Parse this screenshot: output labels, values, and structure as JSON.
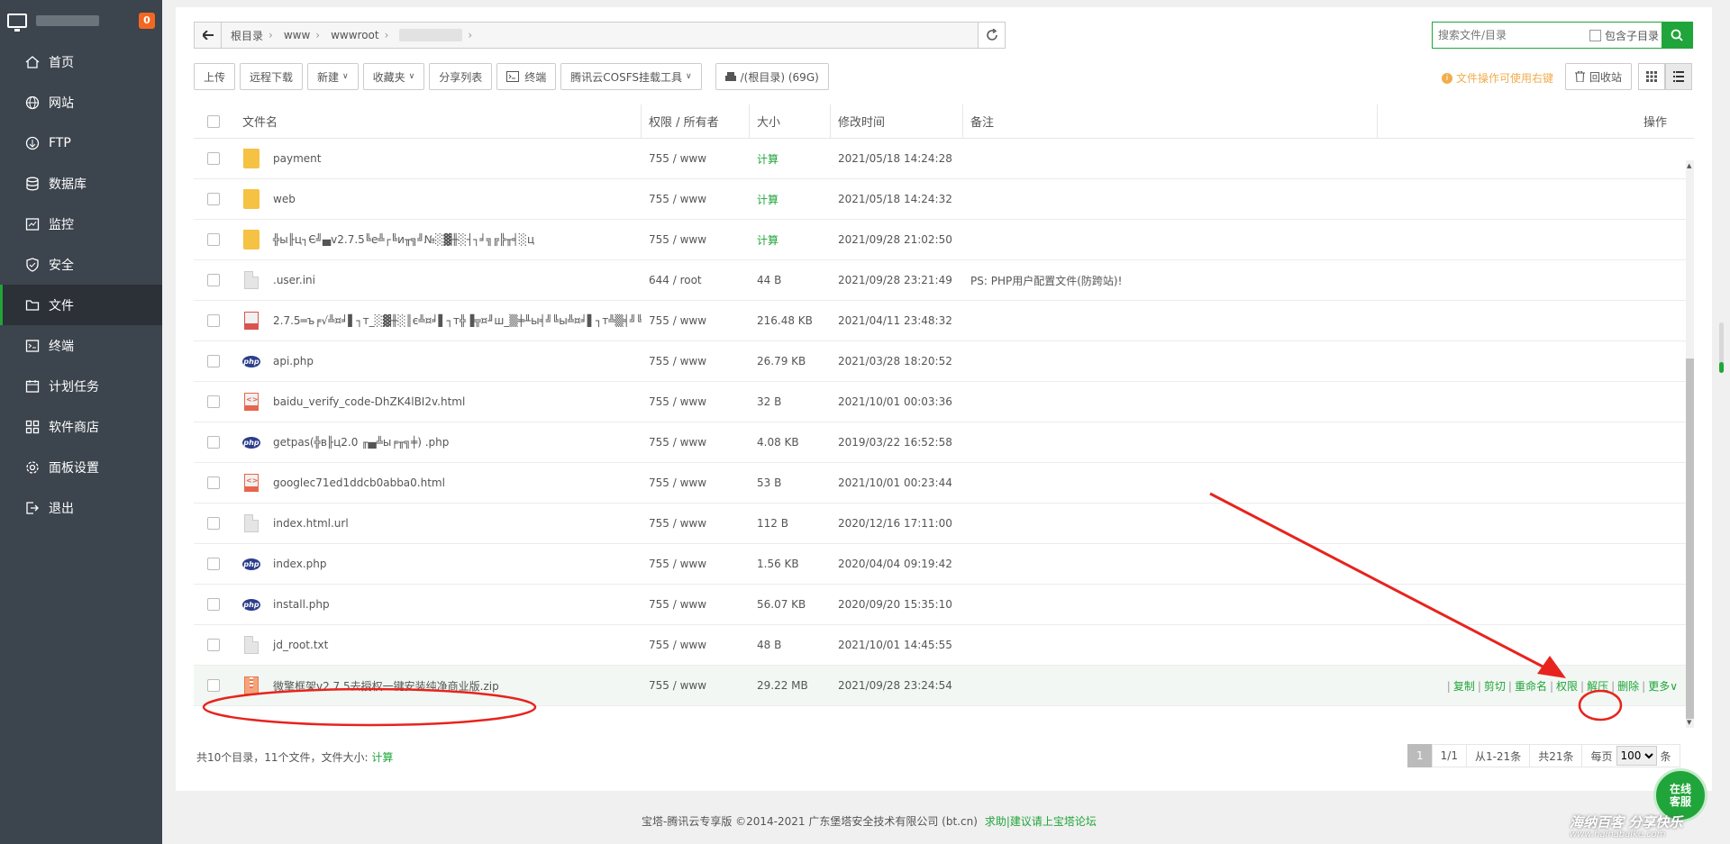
{
  "sidebar": {
    "badge": "0",
    "items": [
      {
        "label": "首页",
        "icon": "home-icon"
      },
      {
        "label": "网站",
        "icon": "globe-icon"
      },
      {
        "label": "FTP",
        "icon": "ftp-icon"
      },
      {
        "label": "数据库",
        "icon": "database-icon"
      },
      {
        "label": "监控",
        "icon": "monitor-icon"
      },
      {
        "label": "安全",
        "icon": "shield-icon"
      },
      {
        "label": "文件",
        "icon": "folder-icon"
      },
      {
        "label": "终端",
        "icon": "terminal-icon"
      },
      {
        "label": "计划任务",
        "icon": "schedule-icon"
      },
      {
        "label": "软件商店",
        "icon": "apps-icon"
      },
      {
        "label": "面板设置",
        "icon": "gear-icon"
      },
      {
        "label": "退出",
        "icon": "logout-icon"
      }
    ]
  },
  "path": {
    "crumbs": [
      "根目录",
      "www",
      "wwwroot"
    ]
  },
  "search": {
    "placeholder": "搜索文件/目录",
    "subdir_label": "包含子目录"
  },
  "toolbar": {
    "upload": "上传",
    "remote_download": "远程下载",
    "new": "新建",
    "favorites": "收藏夹",
    "share_list": "分享列表",
    "terminal": "终端",
    "cosfs": "腾讯云COSFS挂载工具",
    "disk": "/(根目录) (69G)",
    "tip": "文件操作可使用右键",
    "recycle": "回收站"
  },
  "table": {
    "headers": {
      "name": "文件名",
      "perm": "权限 / 所有者",
      "size": "大小",
      "mtime": "修改时间",
      "note": "备注",
      "ops": "操作"
    },
    "rows": [
      {
        "icon": "folder",
        "name": "payment",
        "perm": "755 / www",
        "size": "计算",
        "mtime": "2021/05/18 14:24:28",
        "note": ""
      },
      {
        "icon": "folder",
        "name": "web",
        "perm": "755 / www",
        "size": "计算",
        "mtime": "2021/05/18 14:24:32",
        "note": ""
      },
      {
        "icon": "folder",
        "name": "╬ы╟ц┐Є╝▄v2.7.5╚е╩┌╚и╥╗╝№░▓╫░┤┐╛╗╔╠╥╡░ц",
        "perm": "755 / www",
        "size": "计算",
        "mtime": "2021/09/28 21:02:50",
        "note": ""
      },
      {
        "icon": "doc",
        "name": ".user.ini",
        "perm": "644 / root",
        "size": "44 B",
        "mtime": "2021/09/28 23:21:49",
        "note": "PS: PHP用户配置文件(防跨站)!"
      },
      {
        "icon": "sql",
        "name": "2.7.5═ъ╒√╩¤╛▌┐т_░▓╫░║є╩¤╛▌┐т╬▐╦¤╜ш_▒╪╨ы╡╝╚ы╩¤╛▌┐т╩▒╡╝╚ы_╥╗╝№░▓╫░...",
        "perm": "755 / www",
        "size": "216.48 KB",
        "mtime": "2021/04/11 23:48:32",
        "note": ""
      },
      {
        "icon": "php",
        "name": "api.php",
        "perm": "755 / www",
        "size": "26.79 KB",
        "mtime": "2021/03/28 18:20:52",
        "note": ""
      },
      {
        "icon": "html",
        "name": "baidu_verify_code-DhZK4lBI2v.html",
        "perm": "755 / www",
        "size": "32 B",
        "mtime": "2021/10/01 00:03:36",
        "note": ""
      },
      {
        "icon": "php",
        "name": "getpas(╬в╟ц2.0 ╓▄╩ы╒╥╗╪) .php",
        "perm": "755 / www",
        "size": "4.08 KB",
        "mtime": "2019/03/22 16:52:58",
        "note": ""
      },
      {
        "icon": "html",
        "name": "googlec71ed1ddcb0abba0.html",
        "perm": "755 / www",
        "size": "53 B",
        "mtime": "2021/10/01 00:23:44",
        "note": ""
      },
      {
        "icon": "doc",
        "name": "index.html.url",
        "perm": "755 / www",
        "size": "112 B",
        "mtime": "2020/12/16 17:11:00",
        "note": ""
      },
      {
        "icon": "php",
        "name": "index.php",
        "perm": "755 / www",
        "size": "1.56 KB",
        "mtime": "2020/04/04 09:19:42",
        "note": ""
      },
      {
        "icon": "php",
        "name": "install.php",
        "perm": "755 / www",
        "size": "56.07 KB",
        "mtime": "2020/09/20 15:35:10",
        "note": ""
      },
      {
        "icon": "doc",
        "name": "jd_root.txt",
        "perm": "755 / www",
        "size": "48 B",
        "mtime": "2021/10/01 14:45:55",
        "note": ""
      },
      {
        "icon": "zip",
        "name": "微擎框架v2.7.5去授权一键安装纯净商业版.zip",
        "perm": "755 / www",
        "size": "29.22 MB",
        "mtime": "2021/09/28 23:24:54",
        "note": ""
      }
    ],
    "row_ops": {
      "copy": "复制",
      "cut": "剪切",
      "rename": "重命名",
      "perm": "权限",
      "unzip": "解压",
      "delete": "删除",
      "more": "更多"
    }
  },
  "summary": {
    "text": "共10个目录，11个文件，文件大小:",
    "calc": "计算"
  },
  "pager": {
    "current": "1",
    "pages": "1/1",
    "range": "从1-21条",
    "total": "共21条",
    "per_page_label": "每页",
    "per_page_value": "100",
    "unit": "条"
  },
  "footer": {
    "copyright": "宝塔-腾讯云专享版 ©2014-2021 广东堡塔安全技术有限公司 (bt.cn)",
    "help_link": "求助|建议请上宝塔论坛"
  },
  "online_service": {
    "line1": "在线",
    "line2": "客服"
  },
  "watermark": {
    "main": "海纳百客 分享快乐",
    "sub": "www.hainabaike.com"
  },
  "colors": {
    "accent": "#20a53a",
    "sidebar": "#3c444d",
    "annotation": "#e8231d"
  }
}
